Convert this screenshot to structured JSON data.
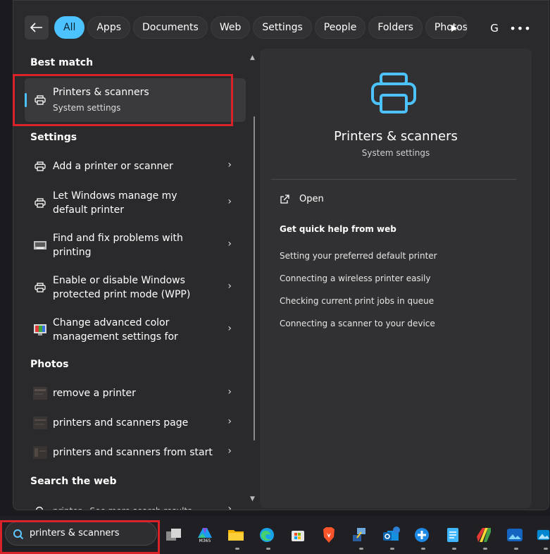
{
  "filters": {
    "back_label": "←",
    "chips": [
      "All",
      "Apps",
      "Documents",
      "Web",
      "Settings",
      "People",
      "Folders",
      "Photos"
    ],
    "active": "All",
    "avatar_letter": "G",
    "more_label": "•••"
  },
  "best_match": {
    "heading": "Best match",
    "title": "Printers & scanners",
    "subtitle": "System settings"
  },
  "settings": {
    "heading": "Settings",
    "items": [
      {
        "label": "Add a printer or scanner"
      },
      {
        "label": "Let Windows manage my default printer"
      },
      {
        "label": "Find and fix problems with printing"
      },
      {
        "label": "Enable or disable Windows protected print mode (WPP)"
      },
      {
        "label": "Change advanced color management settings for"
      }
    ]
  },
  "photos": {
    "heading": "Photos",
    "items": [
      {
        "label": "remove a printer"
      },
      {
        "label": "printers and scanners page"
      },
      {
        "label": "printers and scanners from start"
      }
    ]
  },
  "web": {
    "heading": "Search the web",
    "partial_item": "printer - See more search results"
  },
  "preview": {
    "title": "Printers & scanners",
    "subtitle": "System settings",
    "open_label": "Open",
    "quick_help_heading": "Get quick help from web",
    "links": [
      "Setting your preferred default printer",
      "Connecting a wireless printer easily",
      "Checking current print jobs in queue",
      "Connecting a scanner to your device"
    ]
  },
  "taskbar": {
    "search_value": "printers & scanners",
    "m365_label": "M365",
    "apps": [
      "task-view",
      "microsoft-365",
      "file-explorer",
      "edge",
      "microsoft-store",
      "brave",
      "network-tool",
      "outlook",
      "help-app",
      "notepad",
      "paint-app",
      "photos-app",
      "camera-app"
    ]
  },
  "colors": {
    "accent": "#4cc2ff",
    "highlight_red": "#d8232a"
  }
}
